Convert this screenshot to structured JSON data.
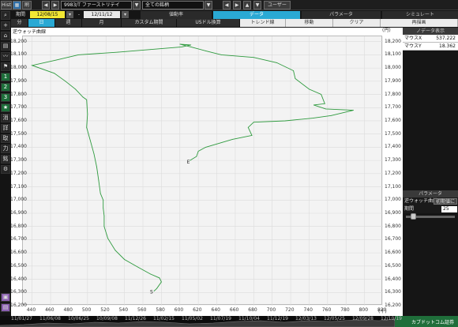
{
  "topbar": {
    "hist": "Hist",
    "stock_code": "9983/T ファーストリテイ",
    "market": "全ての銘柄",
    "user": "ユーザー"
  },
  "toolbar": {
    "period_label": "期間",
    "date_from": "12/08/15",
    "date_sep": "-",
    "date_to": "12/11/12",
    "price_rate": "値動率",
    "tab_data": "データ",
    "tab_param": "パラメータ",
    "tab_sim": "シミュレート"
  },
  "range_tabs": [
    "分",
    "日",
    "週",
    "月",
    "カスタム期間",
    "USドル換算"
  ],
  "right_tabs": [
    "トレンド線",
    "移動",
    "クリア",
    "再描画"
  ],
  "left_icons": [
    "search-icon",
    "plus-icon",
    "bank-icon",
    "chart-icon",
    "line-icon",
    "flag-icon",
    "1",
    "2",
    "3",
    "★",
    "消",
    "詳",
    "取",
    "力",
    "銘",
    "⚙"
  ],
  "chart": {
    "title": "逆ウォッチ曲線",
    "unit_y": "(円)",
    "unit_x": "(千)",
    "y_ticks": [
      "18,200",
      "18,100",
      "18,000",
      "17,900",
      "17,800",
      "17,700",
      "17,600",
      "17,500",
      "17,400",
      "17,300",
      "17,200",
      "17,100",
      "17,000",
      "16,900",
      "16,800",
      "16,700",
      "16,600",
      "16,500",
      "16,400",
      "16,300",
      "16,200"
    ],
    "x_ticks": [
      "440",
      "460",
      "480",
      "500",
      "520",
      "540",
      "560",
      "580",
      "600",
      "620",
      "640",
      "660",
      "680",
      "700",
      "720",
      "740",
      "760",
      "780",
      "800",
      "820"
    ],
    "start_label": "S",
    "end_label": "E"
  },
  "chart_data": {
    "type": "line",
    "title": "逆ウォッチ曲線",
    "xlabel": "(千)",
    "ylabel": "(円)",
    "xlim": [
      430,
      820
    ],
    "ylim": [
      16200,
      18240
    ],
    "series": [
      {
        "values": [
          [
            572,
            16310
          ],
          [
            575,
            16330
          ],
          [
            580,
            16380
          ],
          [
            578,
            16410
          ],
          [
            568,
            16440
          ],
          [
            555,
            16490
          ],
          [
            540,
            16550
          ],
          [
            530,
            16620
          ],
          [
            522,
            16710
          ],
          [
            518,
            16800
          ],
          [
            518,
            16880
          ],
          [
            517,
            16940
          ],
          [
            517,
            17000
          ],
          [
            514,
            17050
          ],
          [
            512,
            17150
          ],
          [
            510,
            17250
          ],
          [
            507,
            17350
          ],
          [
            503,
            17450
          ],
          [
            499,
            17550
          ],
          [
            500,
            17650
          ],
          [
            499,
            17760
          ],
          [
            495,
            17780
          ],
          [
            487,
            17840
          ],
          [
            476,
            17900
          ],
          [
            464,
            17960
          ],
          [
            440,
            18020
          ],
          [
            466,
            18060
          ],
          [
            490,
            18100
          ],
          [
            533,
            18120
          ],
          [
            568,
            18140
          ],
          [
            602,
            18160
          ],
          [
            612,
            18175
          ],
          [
            600,
            18180
          ],
          [
            612,
            18160
          ],
          [
            628,
            18130
          ],
          [
            645,
            18100
          ],
          [
            680,
            18080
          ],
          [
            705,
            18040
          ],
          [
            723,
            17980
          ],
          [
            725,
            17920
          ],
          [
            740,
            17840
          ],
          [
            753,
            17800
          ],
          [
            757,
            17730
          ],
          [
            745,
            17720
          ],
          [
            758,
            17690
          ],
          [
            788,
            17680
          ],
          [
            764,
            17640
          ],
          [
            744,
            17620
          ],
          [
            714,
            17600
          ],
          [
            680,
            17590
          ],
          [
            674,
            17550
          ],
          [
            678,
            17490
          ],
          [
            657,
            17460
          ],
          [
            628,
            17400
          ],
          [
            620,
            17370
          ],
          [
            618,
            17330
          ],
          [
            611,
            17300
          ]
        ]
      }
    ]
  },
  "right_panel": {
    "mouse_header": "ノデータ表示",
    "mouse_x_label": "マウスX",
    "mouse_x": "537.222",
    "mouse_y_label": "マウスY",
    "mouse_y": "18.362",
    "param_header": "パラメータ",
    "param_name": "逆ウォッチ曲線",
    "param_button": "初期値に",
    "period_label": "期間",
    "period_value": "25",
    "slider_value": 0.1
  },
  "bottom_dates": [
    "11/01/27",
    "11/06/08",
    "10/06/25",
    "10/09/08",
    "11/12/26",
    "11/02/15",
    "11/05/02",
    "11/07/19",
    "11/10/04",
    "11/12/19",
    "12/03/13",
    "12/05/25",
    "12/09/28",
    "12/10/19"
  ],
  "bottom_brand": "カブドットコム証券"
}
